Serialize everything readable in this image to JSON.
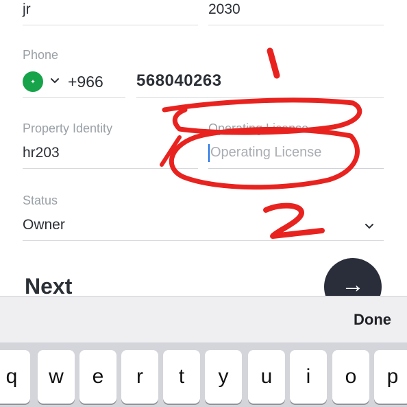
{
  "form": {
    "row1": {
      "left_value": "jr",
      "right_value": "2030"
    },
    "phone": {
      "label": "Phone",
      "country_code": "+966",
      "number": "568040263",
      "flag_icon": "saudi-flag-icon",
      "chevron_icon": "chevron-down-icon"
    },
    "property_identity": {
      "label": "Property Identity",
      "value": "hr203"
    },
    "operating_license": {
      "label": "Operating License",
      "placeholder": "Operating License"
    },
    "status": {
      "label": "Status",
      "value": "Owner",
      "chevron_icon": "chevron-down-icon"
    },
    "next": {
      "label": "Next",
      "arrow_icon": "arrow-right-icon",
      "arrow_glyph": "→"
    }
  },
  "keyboard": {
    "done_label": "Done",
    "keys": [
      "q",
      "w",
      "e",
      "r",
      "t",
      "y",
      "u",
      "i",
      "o",
      "p"
    ]
  },
  "annotations": {
    "mark1": "1",
    "mark2": "2",
    "color": "#e8231f"
  },
  "colors": {
    "fab": "#2a2d3a",
    "cursor": "#1f6fe5",
    "flag": "#16a34a"
  }
}
